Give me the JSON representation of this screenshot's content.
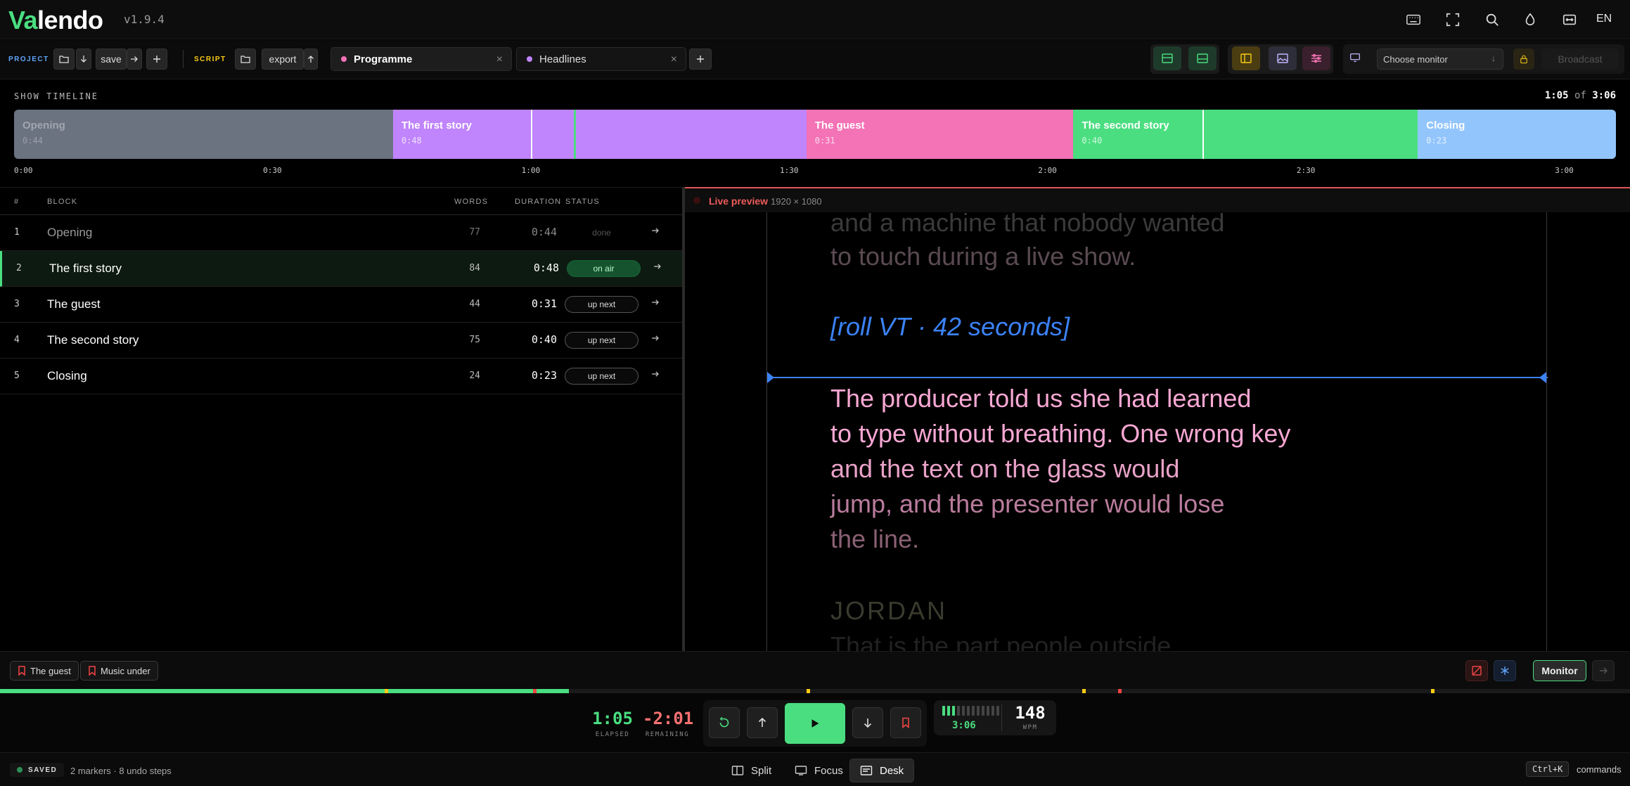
{
  "app": {
    "logo_accent": "Va",
    "logo_rest": "lendo",
    "version": "v1.9.4",
    "language": "EN"
  },
  "top_icons": [
    "keyboard-icon",
    "fullscreen-icon",
    "search-icon",
    "droplet-icon",
    "fit-width-icon"
  ],
  "toolbar": {
    "project_label": "PROJECT",
    "save_label": "save",
    "script_label": "SCRIPT",
    "export_label": "export",
    "tabs": [
      {
        "label": "Programme",
        "color": "#f472b6",
        "close": "×"
      },
      {
        "label": "Headlines",
        "color": "#c084fc",
        "close": "×"
      }
    ],
    "add_tab": "+",
    "monitor_placeholder": "Choose monitor",
    "broadcast_label": "Broadcast"
  },
  "timeline": {
    "label": "SHOW TIMELINE",
    "elapsed": "1:05",
    "of": "of",
    "total": "3:06",
    "total_seconds": 186,
    "playhead_seconds": 65,
    "segments": [
      {
        "title": "Opening",
        "duration": "0:44",
        "seconds": 44,
        "color": "#6b7280"
      },
      {
        "title": "The first story",
        "duration": "0:48",
        "seconds": 48,
        "color": "#c084fc"
      },
      {
        "title": "The guest",
        "duration": "0:31",
        "seconds": 31,
        "color": "#f472b6"
      },
      {
        "title": "The second story",
        "duration": "0:40",
        "seconds": 40,
        "color": "#4ade80"
      },
      {
        "title": "Closing",
        "duration": "0:23",
        "seconds": 23,
        "color": "#93c5fd"
      }
    ],
    "ticks": [
      "0:00",
      "0:30",
      "1:00",
      "1:30",
      "2:00",
      "2:30",
      "3:00"
    ]
  },
  "table": {
    "headers": {
      "num": "#",
      "block": "BLOCK",
      "words": "WORDS",
      "duration": "DURATION",
      "status": "STATUS"
    },
    "rows": [
      {
        "num": "1",
        "block": "Opening",
        "words": "77",
        "duration": "0:44",
        "status": "done"
      },
      {
        "num": "2",
        "block": "The first story",
        "words": "84",
        "duration": "0:48",
        "status": "on air"
      },
      {
        "num": "3",
        "block": "The guest",
        "words": "44",
        "duration": "0:31",
        "status": "up next"
      },
      {
        "num": "4",
        "block": "The second story",
        "words": "75",
        "duration": "0:40",
        "status": "up next"
      },
      {
        "num": "5",
        "block": "Closing",
        "words": "24",
        "duration": "0:23",
        "status": "up next"
      }
    ]
  },
  "preview": {
    "title": "Live preview",
    "resolution": "1920 × 1080",
    "lines": [
      {
        "text": "and a machine that nobody wanted",
        "color": "#3a3a3a",
        "italic": false
      },
      {
        "text": "to touch during a live show.",
        "color": "#5a4a52",
        "italic": false
      },
      {
        "text": "[roll VT · 42 seconds]",
        "color": "#3b82f6",
        "italic": true
      },
      {
        "text": "The producer told us she had learned",
        "color": "#f9a8d4",
        "italic": false
      },
      {
        "text": "to type without breathing. One wrong key",
        "color": "#f9a8d4",
        "italic": false
      },
      {
        "text": "and the text on the glass would",
        "color": "#e9a2c8",
        "italic": false
      },
      {
        "text": "jump, and the presenter would lose",
        "color": "#b97c9c",
        "italic": false
      },
      {
        "text": "the line.",
        "color": "#8a6073",
        "italic": false
      },
      {
        "text": "JORDAN",
        "color": "#3a3a2e",
        "italic": false
      },
      {
        "text": "That is the part people outside",
        "color": "#222222",
        "italic": false
      }
    ]
  },
  "markers": [
    {
      "label": "The guest"
    },
    {
      "label": "Music under"
    }
  ],
  "monitor_label": "Monitor",
  "progress": {
    "fraction": 0.349
  },
  "transport": {
    "elapsed": "1:05",
    "elapsed_label": "ELAPSED",
    "remaining": "-2:01",
    "remaining_label": "REMAINING",
    "total": "3:06",
    "wpm": "148",
    "wpm_label": "WPM"
  },
  "status": {
    "saved": "SAVED",
    "info": "2 markers · 8 undo steps",
    "modes": [
      {
        "label": "Split"
      },
      {
        "label": "Focus"
      },
      {
        "label": "Desk"
      }
    ],
    "shortcut": "Ctrl+K",
    "commands": "commands"
  },
  "colors": {
    "accent": "#4ade80",
    "danger": "#ef4444",
    "amber": "#facc15"
  }
}
